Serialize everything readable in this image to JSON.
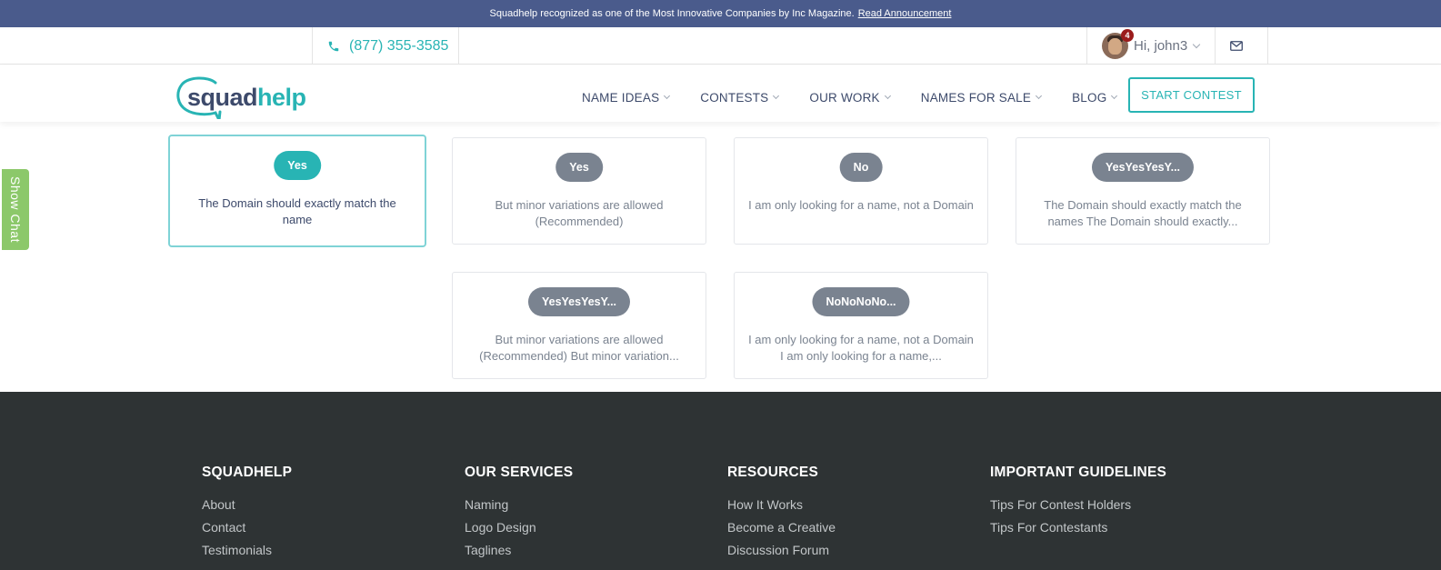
{
  "announcement": {
    "text": "Squadhelp recognized as one of the Most Innovative Companies by Inc Magazine.",
    "link": "Read Announcement"
  },
  "topbar": {
    "phone": "(877) 355-3585",
    "user_greeting": "Hi, john3",
    "notification_count": "4"
  },
  "logo": {
    "part1": "squad",
    "part2": "help"
  },
  "nav": {
    "items": [
      {
        "label": "NAME IDEAS"
      },
      {
        "label": "CONTESTS"
      },
      {
        "label": "OUR WORK"
      },
      {
        "label": "NAMES FOR SALE"
      },
      {
        "label": "BLOG"
      }
    ],
    "start_contest": "START CONTEST"
  },
  "chat": {
    "label": "Show Chat"
  },
  "options": [
    {
      "tag": "Yes",
      "desc": "The Domain should exactly match the name",
      "selected": true
    },
    {
      "tag": "Yes",
      "desc": "But minor variations are allowed (Recommended)",
      "selected": false
    },
    {
      "tag": "No",
      "desc": "I am only looking for a name, not a Domain",
      "selected": false
    },
    {
      "tag": "YesYesYesY...",
      "desc": "The Domain should exactly match the names The Domain should exactly...",
      "selected": false
    },
    {
      "tag": "YesYesYesY...",
      "desc": "But minor variations are allowed (Recommended) But minor variation...",
      "selected": false
    },
    {
      "tag": "NoNoNoNo...",
      "desc": "I am only looking for a name, not a Domain I am only looking for a name,...",
      "selected": false
    }
  ],
  "footer": {
    "columns": [
      {
        "heading": "SQUADHELP",
        "links": [
          "About",
          "Contact",
          "Testimonials"
        ]
      },
      {
        "heading": "OUR SERVICES",
        "links": [
          "Naming",
          "Logo Design",
          "Taglines"
        ]
      },
      {
        "heading": "RESOURCES",
        "links": [
          "How It Works",
          "Become a Creative",
          "Discussion Forum"
        ]
      },
      {
        "heading": "IMPORTANT GUIDELINES",
        "links": [
          "Tips For Contest Holders",
          "Tips For Contestants"
        ]
      }
    ]
  },
  "colors": {
    "brand_teal": "#28b4b4",
    "banner": "#4a5b8c",
    "navy": "#3d4a6b",
    "footer_bg": "#2e3334",
    "chat_green": "#8cc86a"
  }
}
